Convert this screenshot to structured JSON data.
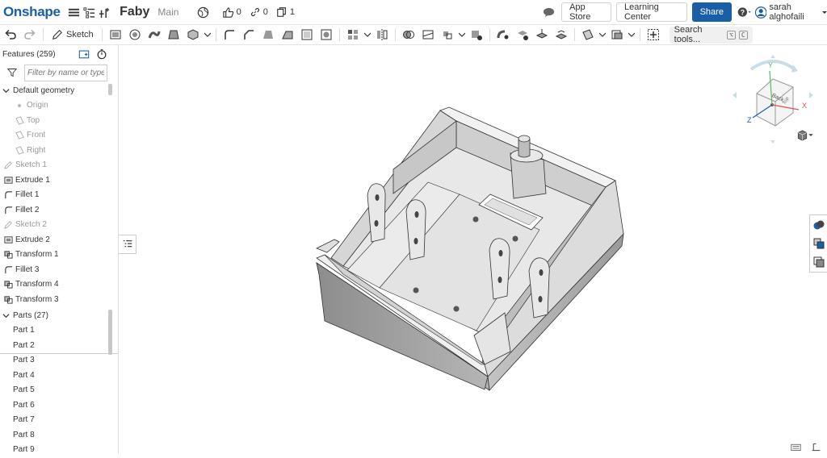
{
  "header": {
    "logo": "Onshape",
    "doc_name": "Faby",
    "branch": "Main",
    "likes": "0",
    "links": "0",
    "copies": "1",
    "app_store": "App Store",
    "learning_center": "Learning Center",
    "share": "Share",
    "user": "sarah alghofaili",
    "help": "?"
  },
  "toolbar": {
    "sketch_label": "Sketch",
    "search_placeholder": "Search tools...",
    "shortcut_mod": "⌥",
    "shortcut_key": "C"
  },
  "features": {
    "title": "Features (259)",
    "filter_placeholder": "Filter by name or type",
    "default_geometry": "Default geometry",
    "items": [
      {
        "label": "Origin",
        "icon": "origin-dot-icon",
        "dim": true
      },
      {
        "label": "Top",
        "icon": "plane-icon",
        "dim": true
      },
      {
        "label": "Front",
        "icon": "plane-icon",
        "dim": true
      },
      {
        "label": "Right",
        "icon": "plane-icon",
        "dim": true
      },
      {
        "label": "Sketch 1",
        "icon": "sketch-icon",
        "dim": true
      },
      {
        "label": "Extrude 1",
        "icon": "extrude-icon",
        "dim": false
      },
      {
        "label": "Fillet 1",
        "icon": "fillet-icon",
        "dim": false
      },
      {
        "label": "Fillet 2",
        "icon": "fillet-icon",
        "dim": false
      },
      {
        "label": "Sketch 2",
        "icon": "sketch-icon",
        "dim": true
      },
      {
        "label": "Extrude 2",
        "icon": "extrude-icon",
        "dim": false
      },
      {
        "label": "Transform 1",
        "icon": "transform-icon",
        "dim": false
      },
      {
        "label": "Fillet 3",
        "icon": "fillet-icon",
        "dim": false
      },
      {
        "label": "Transform 4",
        "icon": "transform-icon",
        "dim": false
      },
      {
        "label": "Transform 3",
        "icon": "transform-icon",
        "dim": false
      }
    ]
  },
  "parts": {
    "title": "Parts (27)",
    "items": [
      "Part 1",
      "Part 2",
      "Part 3",
      "Part 4",
      "Part 5",
      "Part 6",
      "Part 7",
      "Part 8",
      "Part 9"
    ]
  },
  "view_cube": {
    "face_label": "Back",
    "side_label": "Top",
    "axis_x": "X",
    "axis_y": "Y",
    "axis_z": "Z"
  },
  "colors": {
    "brand": "#1a5ea8",
    "share_bg": "#1a5ea8",
    "axis_x": "#d9534f",
    "axis_y": "#5cb85c",
    "axis_z": "#1a5ea8"
  }
}
